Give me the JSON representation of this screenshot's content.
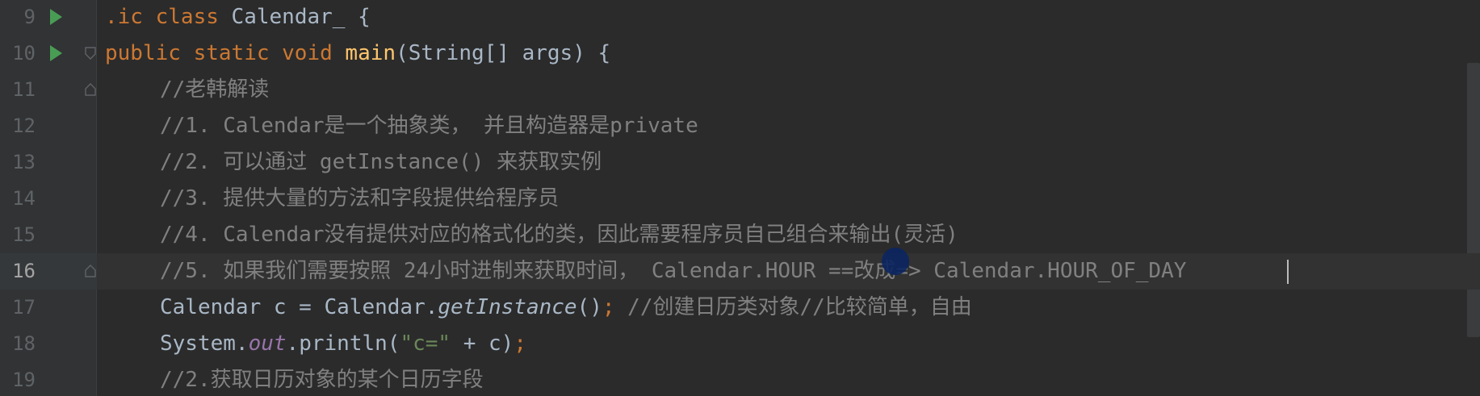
{
  "editor": {
    "lines": [
      {
        "number": "9"
      },
      {
        "number": "10"
      },
      {
        "number": "11"
      },
      {
        "number": "12"
      },
      {
        "number": "13"
      },
      {
        "number": "14"
      },
      {
        "number": "15"
      },
      {
        "number": "16"
      },
      {
        "number": "17"
      },
      {
        "number": "18"
      },
      {
        "number": "19"
      }
    ],
    "code": {
      "l9": {
        "prefix": ".ic ",
        "kw_class": "class",
        "name": " Calendar_ {"
      },
      "l10": {
        "kw1": "public",
        "kw2": " static",
        "kw3": " void",
        "fn": " main",
        "rest": "(String[] args) {"
      },
      "l11": {
        "comment": "//老韩解读"
      },
      "l12": {
        "comment": "//1. Calendar是一个抽象类， 并且构造器是private"
      },
      "l13": {
        "comment": "//2. 可以通过 getInstance() 来获取实例"
      },
      "l14": {
        "comment": "//3. 提供大量的方法和字段提供给程序员"
      },
      "l15": {
        "comment": "//4. Calendar没有提供对应的格式化的类，因此需要程序员自己组合来输出(灵活)"
      },
      "l16": {
        "comment": "//5. 如果我们需要按照 24小时进制来获取时间， Calendar.HOUR ==改成=> Calendar.HOUR_OF_DAY"
      },
      "l17": {
        "a": "Calendar c = Calendar.",
        "method": "getInstance",
        "b": "()",
        "semi": ";",
        "comment": " //创建日历类对象//比较简单，自由"
      },
      "l18": {
        "a": "System.",
        "field": "out",
        "b": ".println(",
        "str": "\"c=\"",
        "c": " + c)",
        "semi": ";"
      },
      "l19": {
        "comment": "//2.获取日历对象的某个日历字段"
      }
    },
    "current_line": "16"
  }
}
